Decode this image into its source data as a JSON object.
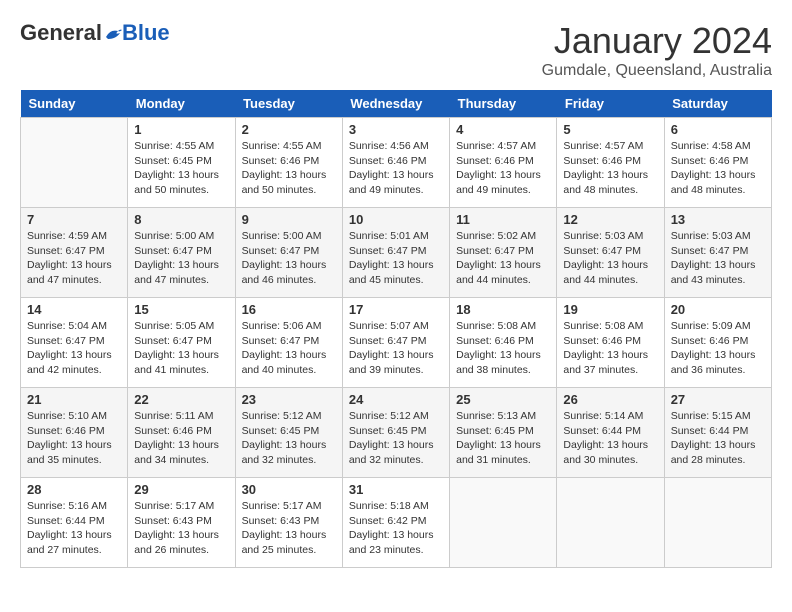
{
  "header": {
    "logo_general": "General",
    "logo_blue": "Blue",
    "month_title": "January 2024",
    "location": "Gumdale, Queensland, Australia"
  },
  "weekdays": [
    "Sunday",
    "Monday",
    "Tuesday",
    "Wednesday",
    "Thursday",
    "Friday",
    "Saturday"
  ],
  "weeks": [
    [
      {
        "day": "",
        "sunrise": "",
        "sunset": "",
        "daylight": ""
      },
      {
        "day": "1",
        "sunrise": "Sunrise: 4:55 AM",
        "sunset": "Sunset: 6:45 PM",
        "daylight": "Daylight: 13 hours and 50 minutes."
      },
      {
        "day": "2",
        "sunrise": "Sunrise: 4:55 AM",
        "sunset": "Sunset: 6:46 PM",
        "daylight": "Daylight: 13 hours and 50 minutes."
      },
      {
        "day": "3",
        "sunrise": "Sunrise: 4:56 AM",
        "sunset": "Sunset: 6:46 PM",
        "daylight": "Daylight: 13 hours and 49 minutes."
      },
      {
        "day": "4",
        "sunrise": "Sunrise: 4:57 AM",
        "sunset": "Sunset: 6:46 PM",
        "daylight": "Daylight: 13 hours and 49 minutes."
      },
      {
        "day": "5",
        "sunrise": "Sunrise: 4:57 AM",
        "sunset": "Sunset: 6:46 PM",
        "daylight": "Daylight: 13 hours and 48 minutes."
      },
      {
        "day": "6",
        "sunrise": "Sunrise: 4:58 AM",
        "sunset": "Sunset: 6:46 PM",
        "daylight": "Daylight: 13 hours and 48 minutes."
      }
    ],
    [
      {
        "day": "7",
        "sunrise": "Sunrise: 4:59 AM",
        "sunset": "Sunset: 6:47 PM",
        "daylight": "Daylight: 13 hours and 47 minutes."
      },
      {
        "day": "8",
        "sunrise": "Sunrise: 5:00 AM",
        "sunset": "Sunset: 6:47 PM",
        "daylight": "Daylight: 13 hours and 47 minutes."
      },
      {
        "day": "9",
        "sunrise": "Sunrise: 5:00 AM",
        "sunset": "Sunset: 6:47 PM",
        "daylight": "Daylight: 13 hours and 46 minutes."
      },
      {
        "day": "10",
        "sunrise": "Sunrise: 5:01 AM",
        "sunset": "Sunset: 6:47 PM",
        "daylight": "Daylight: 13 hours and 45 minutes."
      },
      {
        "day": "11",
        "sunrise": "Sunrise: 5:02 AM",
        "sunset": "Sunset: 6:47 PM",
        "daylight": "Daylight: 13 hours and 44 minutes."
      },
      {
        "day": "12",
        "sunrise": "Sunrise: 5:03 AM",
        "sunset": "Sunset: 6:47 PM",
        "daylight": "Daylight: 13 hours and 44 minutes."
      },
      {
        "day": "13",
        "sunrise": "Sunrise: 5:03 AM",
        "sunset": "Sunset: 6:47 PM",
        "daylight": "Daylight: 13 hours and 43 minutes."
      }
    ],
    [
      {
        "day": "14",
        "sunrise": "Sunrise: 5:04 AM",
        "sunset": "Sunset: 6:47 PM",
        "daylight": "Daylight: 13 hours and 42 minutes."
      },
      {
        "day": "15",
        "sunrise": "Sunrise: 5:05 AM",
        "sunset": "Sunset: 6:47 PM",
        "daylight": "Daylight: 13 hours and 41 minutes."
      },
      {
        "day": "16",
        "sunrise": "Sunrise: 5:06 AM",
        "sunset": "Sunset: 6:47 PM",
        "daylight": "Daylight: 13 hours and 40 minutes."
      },
      {
        "day": "17",
        "sunrise": "Sunrise: 5:07 AM",
        "sunset": "Sunset: 6:47 PM",
        "daylight": "Daylight: 13 hours and 39 minutes."
      },
      {
        "day": "18",
        "sunrise": "Sunrise: 5:08 AM",
        "sunset": "Sunset: 6:46 PM",
        "daylight": "Daylight: 13 hours and 38 minutes."
      },
      {
        "day": "19",
        "sunrise": "Sunrise: 5:08 AM",
        "sunset": "Sunset: 6:46 PM",
        "daylight": "Daylight: 13 hours and 37 minutes."
      },
      {
        "day": "20",
        "sunrise": "Sunrise: 5:09 AM",
        "sunset": "Sunset: 6:46 PM",
        "daylight": "Daylight: 13 hours and 36 minutes."
      }
    ],
    [
      {
        "day": "21",
        "sunrise": "Sunrise: 5:10 AM",
        "sunset": "Sunset: 6:46 PM",
        "daylight": "Daylight: 13 hours and 35 minutes."
      },
      {
        "day": "22",
        "sunrise": "Sunrise: 5:11 AM",
        "sunset": "Sunset: 6:46 PM",
        "daylight": "Daylight: 13 hours and 34 minutes."
      },
      {
        "day": "23",
        "sunrise": "Sunrise: 5:12 AM",
        "sunset": "Sunset: 6:45 PM",
        "daylight": "Daylight: 13 hours and 32 minutes."
      },
      {
        "day": "24",
        "sunrise": "Sunrise: 5:12 AM",
        "sunset": "Sunset: 6:45 PM",
        "daylight": "Daylight: 13 hours and 32 minutes."
      },
      {
        "day": "25",
        "sunrise": "Sunrise: 5:13 AM",
        "sunset": "Sunset: 6:45 PM",
        "daylight": "Daylight: 13 hours and 31 minutes."
      },
      {
        "day": "26",
        "sunrise": "Sunrise: 5:14 AM",
        "sunset": "Sunset: 6:44 PM",
        "daylight": "Daylight: 13 hours and 30 minutes."
      },
      {
        "day": "27",
        "sunrise": "Sunrise: 5:15 AM",
        "sunset": "Sunset: 6:44 PM",
        "daylight": "Daylight: 13 hours and 28 minutes."
      }
    ],
    [
      {
        "day": "28",
        "sunrise": "Sunrise: 5:16 AM",
        "sunset": "Sunset: 6:44 PM",
        "daylight": "Daylight: 13 hours and 27 minutes."
      },
      {
        "day": "29",
        "sunrise": "Sunrise: 5:17 AM",
        "sunset": "Sunset: 6:43 PM",
        "daylight": "Daylight: 13 hours and 26 minutes."
      },
      {
        "day": "30",
        "sunrise": "Sunrise: 5:17 AM",
        "sunset": "Sunset: 6:43 PM",
        "daylight": "Daylight: 13 hours and 25 minutes."
      },
      {
        "day": "31",
        "sunrise": "Sunrise: 5:18 AM",
        "sunset": "Sunset: 6:42 PM",
        "daylight": "Daylight: 13 hours and 23 minutes."
      },
      {
        "day": "",
        "sunrise": "",
        "sunset": "",
        "daylight": ""
      },
      {
        "day": "",
        "sunrise": "",
        "sunset": "",
        "daylight": ""
      },
      {
        "day": "",
        "sunrise": "",
        "sunset": "",
        "daylight": ""
      }
    ]
  ]
}
